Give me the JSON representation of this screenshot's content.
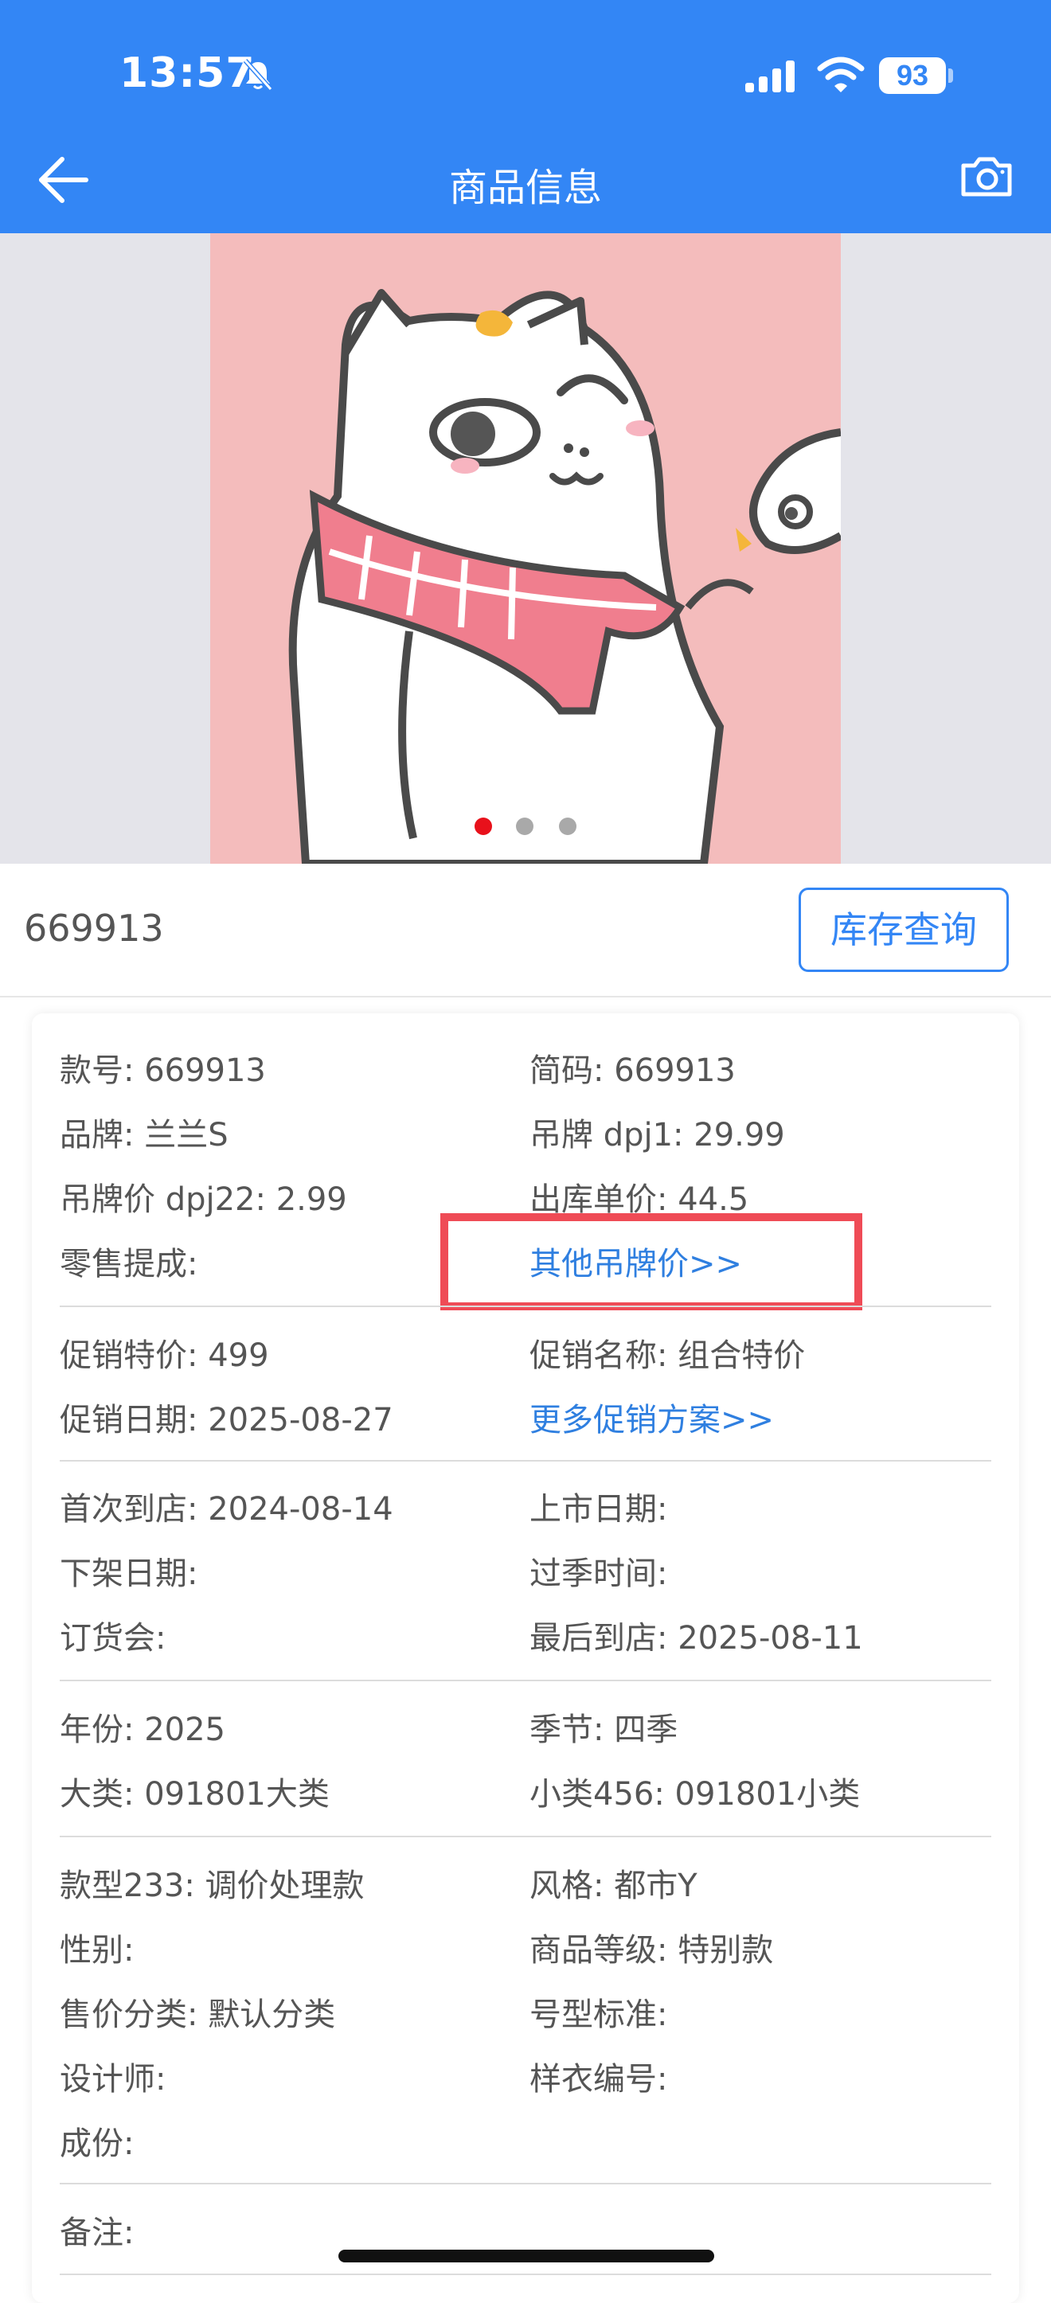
{
  "status_bar": {
    "time": "13:57",
    "battery": "93"
  },
  "header": {
    "title": "商品信息"
  },
  "carousel": {
    "dots": 3,
    "active_index": 0,
    "active_dot_color": "#e8111b"
  },
  "product": {
    "style_number": "669913",
    "stock_query_label": "库存查询"
  },
  "sections": [
    [
      {
        "text": "款号: 669913"
      },
      {
        "text": "简码: 669913"
      },
      {
        "text": "品牌: 兰兰S"
      },
      {
        "text": "吊牌 dpj1: 29.99"
      },
      {
        "text": "吊牌价 dpj22: 2.99"
      },
      {
        "text": "出库单价: 44.5"
      },
      {
        "text": "零售提成:"
      },
      {
        "text": "其他吊牌价>>",
        "link": true
      }
    ],
    [
      {
        "text": "促销特价: 499"
      },
      {
        "text": "促销名称: 组合特价"
      },
      {
        "text": "促销日期: 2025-08-27"
      },
      {
        "text": "更多促销方案>>",
        "link": true
      }
    ],
    [
      {
        "text": "首次到店: 2024-08-14"
      },
      {
        "text": "上市日期:"
      },
      {
        "text": "下架日期:"
      },
      {
        "text": "过季时间:"
      },
      {
        "text": "订货会:"
      },
      {
        "text": "最后到店: 2025-08-11"
      }
    ],
    [
      {
        "text": "年份: 2025"
      },
      {
        "text": "季节: 四季"
      },
      {
        "text": "大类: 091801大类"
      },
      {
        "text": "小类456: 091801小类"
      }
    ],
    [
      {
        "text": "款型233: 调价处理款"
      },
      {
        "text": "风格: 都市Y"
      },
      {
        "text": "性别:"
      },
      {
        "text": "商品等级: 特别款"
      },
      {
        "text": "售价分类: 默认分类"
      },
      {
        "text": "号型标准:"
      },
      {
        "text": "设计师:"
      },
      {
        "text": "样衣编号:"
      },
      {
        "text": "成份:"
      }
    ],
    [
      {
        "text": "备注:"
      }
    ]
  ],
  "colors": {
    "header": "#3386f5",
    "link": "#2f7fe0",
    "highlight": "#ef4b56"
  }
}
